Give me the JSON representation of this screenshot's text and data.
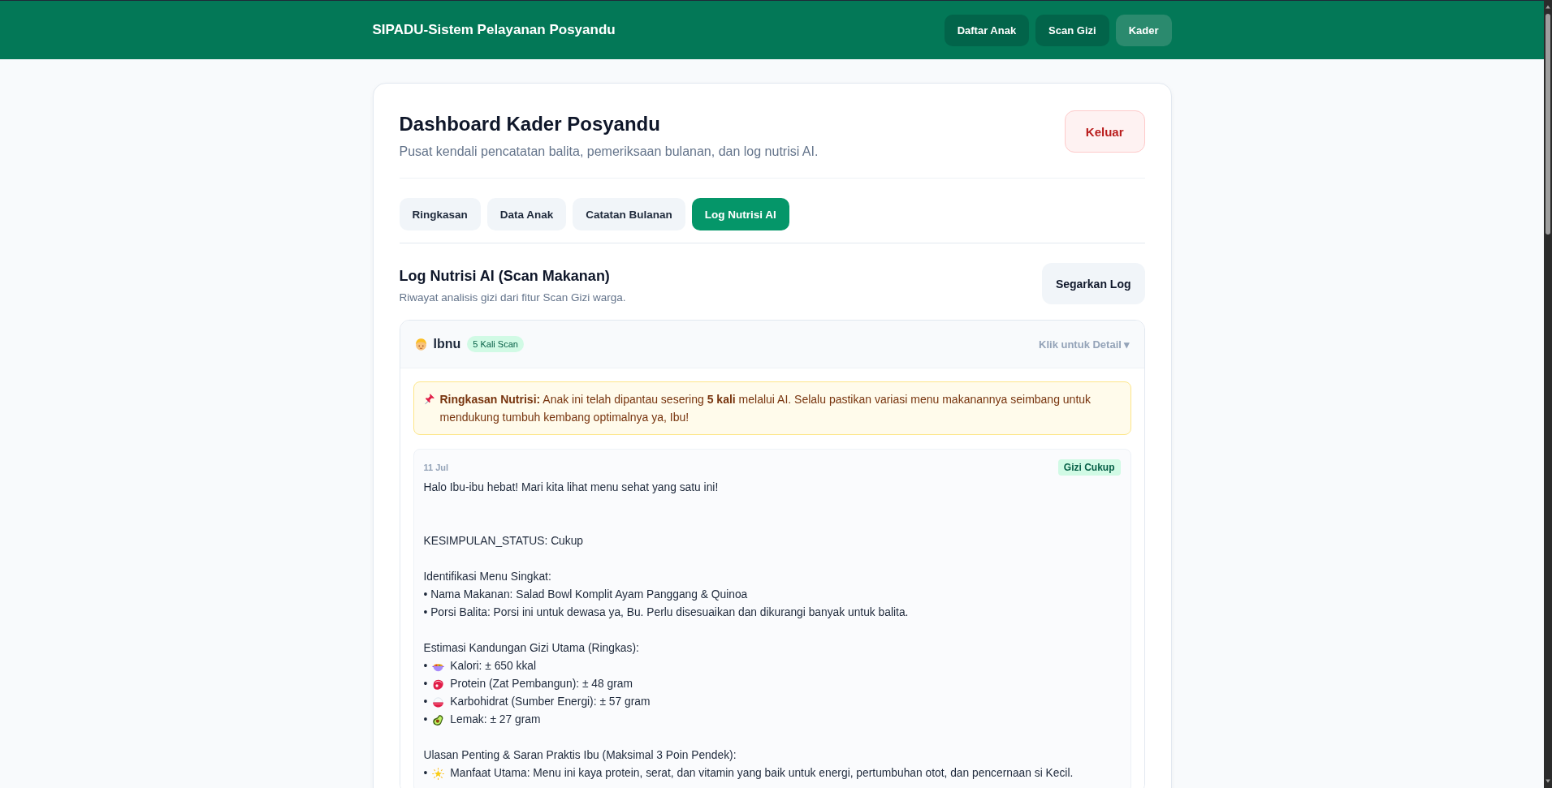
{
  "navbar": {
    "brand": "SIPADU-Sistem Pelayanan Posyandu",
    "links": [
      {
        "label": "Daftar Anak",
        "selected": false
      },
      {
        "label": "Scan Gizi",
        "selected": false
      },
      {
        "label": "Kader",
        "selected": true
      }
    ]
  },
  "dashboard": {
    "title": "Dashboard Kader Posyandu",
    "subtitle": "Pusat kendali pencatatan balita, pemeriksaan bulanan, dan log nutrisi AI.",
    "logout_button": "Keluar",
    "tabs": [
      {
        "label": "Ringkasan",
        "selected": false
      },
      {
        "label": "Data Anak",
        "selected": false
      },
      {
        "label": "Catatan Bulanan",
        "selected": false
      },
      {
        "label": "Log Nutrisi AI",
        "selected": true
      }
    ],
    "section": {
      "title": "Log Nutrisi AI (Scan Makanan)",
      "subtitle": "Riwayat analisis gizi dari fitur Scan Gizi warga.",
      "refresh_button": "Segarkan Log"
    },
    "child_logs": [
      {
        "name": "Ibnu",
        "scan_count": "5 Kali Scan",
        "detail_hint": "Klik untuk Detail ▾",
        "expanded": true,
        "summary": "**Ringkasan Nutrisi:** Anak ini telah dipantau sesering **5 kali** melalui AI. Selalu pastikan variasi menu makanannya seimbang untuk mendukung tumbuh kembang optimalnya ya, Ibu!",
        "entries": [
          {
            "date": "11 Jul",
            "status": "Gizi Cukup",
            "paragraphs": [
              {
                "lines": [
                  {
                    "kind": "plain",
                    "text": "Halo Ibu-ibu hebat! Mari kita lihat menu sehat yang satu ini!"
                  }
                ]
              },
              {
                "lines": [
                  {
                    "kind": "plain",
                    "text": "KESIMPULAN_STATUS: Cukup"
                  }
                ]
              },
              {
                "lines": [
                  {
                    "kind": "plain",
                    "text": "Identifikasi Menu Singkat:"
                  },
                  {
                    "kind": "plain",
                    "text": "• Nama Makanan: Salad Bowl Komplit Ayam Panggang & Quinoa"
                  },
                  {
                    "kind": "plain",
                    "text": "• Porsi Balita: Porsi ini untuk dewasa ya, Bu. Perlu disesuaikan dan dikurangi banyak untuk balita."
                  }
                ]
              },
              {
                "lines": [
                  {
                    "kind": "plain",
                    "text": "Estimasi Kandungan Gizi Utama (Ringkas):"
                  },
                  {
                    "kind": "icon",
                    "marker": "•",
                    "text": "Kalori: ± 650 kkal"
                  },
                  {
                    "kind": "icon",
                    "marker": "•",
                    "text": "Protein (Zat Pembangun): ± 48 gram"
                  },
                  {
                    "kind": "icon",
                    "marker": "•",
                    "text": "Karbohidrat (Sumber Energi): ± 57 gram"
                  },
                  {
                    "kind": "icon",
                    "marker": "•",
                    "text": "Lemak: ± 27 gram"
                  }
                ]
              },
              {
                "lines": [
                  {
                    "kind": "plain",
                    "text": "Ulasan Penting & Saran Praktis Ibu (Maksimal 3 Poin Pendek):"
                  },
                  {
                    "kind": "icon",
                    "marker": "•",
                    "text": "Manfaat Utama: Menu ini kaya protein, serat, dan vitamin yang baik untuk energi, pertumbuhan otot, dan pencernaan si Kecil."
                  }
                ]
              }
            ]
          }
        ]
      }
    ]
  }
}
